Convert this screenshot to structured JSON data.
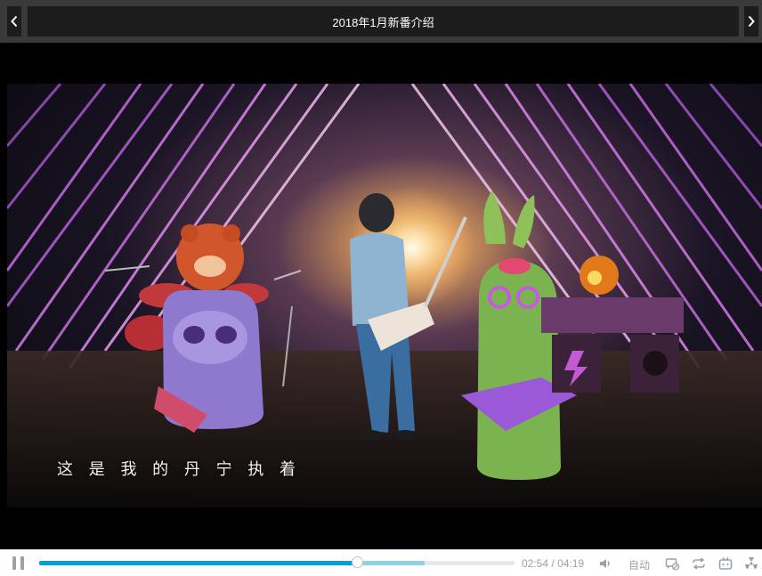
{
  "header": {
    "title": "2018年1月新番介绍",
    "prev_icon": "chevron-left-icon",
    "next_icon": "chevron-right-icon"
  },
  "video": {
    "subtitle": "这 是 我 的 丹 宁 执 着"
  },
  "controls": {
    "current_time": "02:54",
    "separator": "/",
    "duration": "04:19",
    "played_fraction": 0.67,
    "buffered_fraction": 0.81,
    "auto_label": "自动",
    "icons": [
      "pause-icon",
      "volume-icon",
      "danmaku-toggle-icon",
      "loop-icon",
      "tv-mascot-icon",
      "radiation-icon"
    ]
  },
  "colors": {
    "accent": "#00a1d6",
    "buffered": "#8fd0e5",
    "header_bg": "#3a3a3a",
    "control_text": "#99a2aa"
  }
}
